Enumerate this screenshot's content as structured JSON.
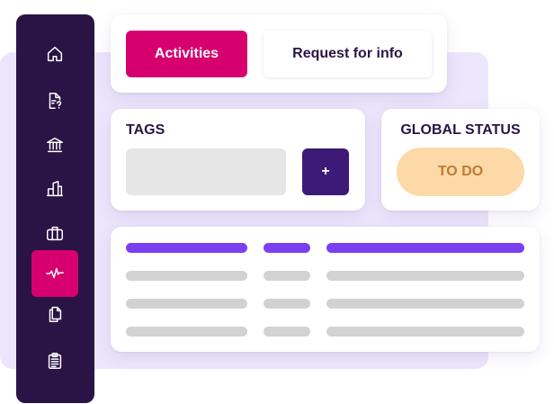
{
  "sidebar": {
    "items": [
      {
        "icon": "home-icon",
        "active": false
      },
      {
        "icon": "document-question-icon",
        "active": false
      },
      {
        "icon": "bank-icon",
        "active": false
      },
      {
        "icon": "buildings-icon",
        "active": false
      },
      {
        "icon": "briefcase-icon",
        "active": false
      },
      {
        "icon": "activity-pulse-icon",
        "active": true
      },
      {
        "icon": "copy-files-icon",
        "active": false
      },
      {
        "icon": "clipboard-icon",
        "active": false
      }
    ]
  },
  "tabs": {
    "activities": "Activities",
    "request_for_info": "Request for info"
  },
  "tags": {
    "title": "TAGS",
    "input_value": "",
    "add_label": "+"
  },
  "global_status": {
    "title": "GLOBAL STATUS",
    "value": "TO DO"
  },
  "colors": {
    "sidebar_bg": "#2a1446",
    "accent_magenta": "#d6006e",
    "button_purple": "#3d1a78",
    "header_bar": "#7b3ff2",
    "status_pill_bg": "#fdd9a8",
    "status_pill_text": "#c27a34",
    "background_lavender": "#ece6fc"
  }
}
